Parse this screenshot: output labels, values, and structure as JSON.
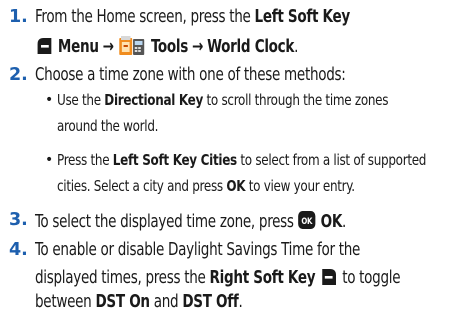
{
  "steps": [
    {
      "number": "1.",
      "line1": {
        "pre": "From the Home screen, press the ",
        "bold": "Left Soft Key"
      },
      "line2": {
        "menu": "Menu",
        "arrow1": "→",
        "tools": "Tools",
        "arrow2": "→",
        "world_clock": "World Clock",
        "period": "."
      }
    },
    {
      "number": "2.",
      "text": "Choose a time zone with one of these methods:",
      "bullets": [
        {
          "pre": "Use the ",
          "bold": "Directional Key",
          "post": " to scroll through the time zones",
          "cont": "around the world."
        },
        {
          "pre": "Press the ",
          "bold": "Left Soft Key Cities",
          "post": " to select from a list of supported",
          "cont_pre": "cities. Select a city and press ",
          "cont_bold": "OK",
          "cont_post": " to view your entry."
        }
      ]
    },
    {
      "number": "3.",
      "pre": "To select the displayed time zone, press ",
      "ok_badge": "OK",
      "bold": "OK",
      "post": "."
    },
    {
      "number": "4.",
      "line1": "To enable or disable Daylight Savings Time for the",
      "line2": {
        "pre": "displayed times, press the ",
        "bold": "Right Soft Key",
        "post": " to toggle"
      },
      "line3": {
        "pre": "between ",
        "bold1": "DST On",
        "mid": " and ",
        "bold2": "DST Off",
        "post": "."
      }
    }
  ],
  "colors": {
    "step_number": "#1d5fae",
    "key_icon": "#1a1a1a",
    "ok_badge": "#1a1a1a",
    "tools_orange": "#f08c1e"
  },
  "icons": [
    "left-soft-key-icon",
    "tools-icon",
    "ok-key-icon",
    "right-soft-key-icon"
  ]
}
